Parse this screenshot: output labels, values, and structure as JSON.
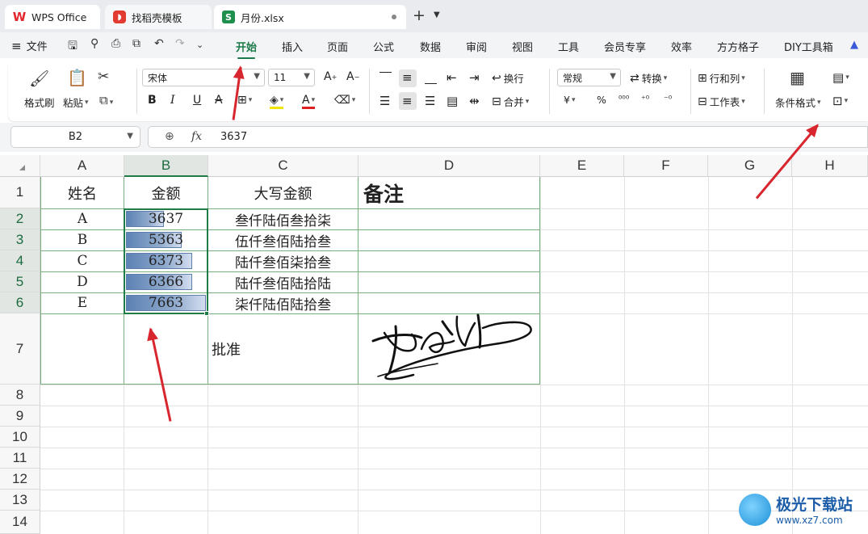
{
  "tabs": {
    "wps_label": "WPS Office",
    "template_label": "找稻壳模板",
    "file_label": "月份.xlsx",
    "add": "+",
    "more": "⌄"
  },
  "menu": {
    "file_label": "文件",
    "tabs": [
      "开始",
      "插入",
      "页面",
      "公式",
      "数据",
      "审阅",
      "视图",
      "工具",
      "会员专享",
      "效率",
      "方方格子",
      "DIY工具箱"
    ],
    "active_tab": "开始"
  },
  "ribbon": {
    "format_painter": "格式刷",
    "paste": "粘贴",
    "font_name": "宋体",
    "font_size": "11",
    "wrap": "换行",
    "merge": "合并",
    "number_format": "常规",
    "convert": "转换",
    "row_col": "行和列",
    "worksheet": "工作表",
    "conditional_format": "条件格式",
    "bold": "B",
    "italic": "I",
    "underline": "U",
    "strike": "A",
    "currency": "¥",
    "percent": "%"
  },
  "formula_bar": {
    "cell_ref": "B2",
    "fx": "fx",
    "value": "3637"
  },
  "grid": {
    "columns": [
      "A",
      "B",
      "C",
      "D",
      "E",
      "F",
      "G",
      "H"
    ],
    "rows": [
      "1",
      "2",
      "3",
      "4",
      "5",
      "6",
      "7",
      "8",
      "9",
      "10",
      "11",
      "12",
      "13",
      "14"
    ],
    "header": {
      "name": "姓名",
      "amount": "金额",
      "uppercase": "大写金额",
      "note": "备注"
    },
    "records": [
      {
        "name": "A",
        "amount": "3637",
        "uppercase": "叁仟陆佰叁拾柒",
        "bar_fraction": 0.47
      },
      {
        "name": "B",
        "amount": "5363",
        "uppercase": "伍仟叁佰陆拾叁",
        "bar_fraction": 0.7
      },
      {
        "name": "C",
        "amount": "6373",
        "uppercase": "陆仟叁佰柒拾叁",
        "bar_fraction": 0.83
      },
      {
        "name": "D",
        "amount": "6366",
        "uppercase": "陆仟叁佰陆拾陆",
        "bar_fraction": 0.83
      },
      {
        "name": "E",
        "amount": "7663",
        "uppercase": "柒仟陆佰陆拾叁",
        "bar_fraction": 1.0
      }
    ],
    "approve_label": "批准"
  },
  "watermark": {
    "title": "极光下载站",
    "url": "www.xz7.com"
  },
  "colors": {
    "accent_green": "#1c7a4b",
    "annotation_red": "#d8262e",
    "databar_blue": "#5c82b4"
  }
}
